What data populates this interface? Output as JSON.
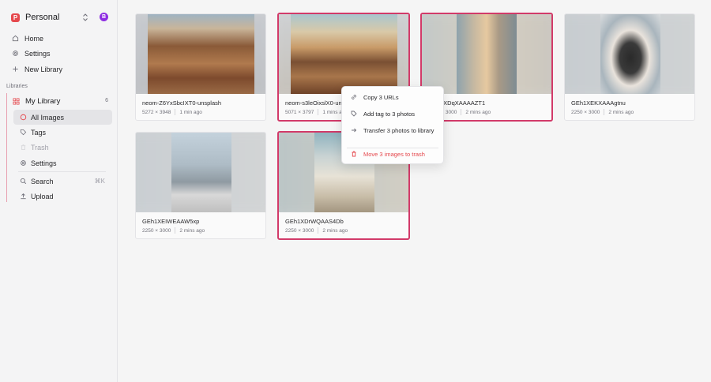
{
  "workspace": {
    "logo_letter": "P",
    "name": "Personal",
    "avatar_letter": "B"
  },
  "nav": [
    {
      "label": "Home",
      "icon": "home-icon"
    },
    {
      "label": "Settings",
      "icon": "gear-icon"
    },
    {
      "label": "New Library",
      "icon": "plus-icon"
    }
  ],
  "libraries_label": "Libraries",
  "library": {
    "name": "My Library",
    "count": "6",
    "items": [
      {
        "label": "All Images",
        "icon": "circle-icon",
        "active": true
      },
      {
        "label": "Tags",
        "icon": "tag-icon"
      },
      {
        "label": "Trash",
        "icon": "trash-icon",
        "disabled": true
      },
      {
        "label": "Settings",
        "icon": "gear-icon"
      }
    ],
    "search_label": "Search",
    "search_shortcut": "⌘K",
    "upload_label": "Upload"
  },
  "images": [
    {
      "name": "neom-Z6YxSbcIXT0-unsplash",
      "dims": "5272 × 3948",
      "time": "1 min ago",
      "selected": false
    },
    {
      "name": "neom-s3leOixslX0-unsplash",
      "dims": "5071 × 3797",
      "time": "1 mins ago",
      "selected": true
    },
    {
      "name": "GEh1XDqXAAAAZT1",
      "dims": "2250 × 3000",
      "time": "2 mins ago",
      "selected": true
    },
    {
      "name": "GEh1XEKXAAAgtnu",
      "dims": "2250 × 3000",
      "time": "2 mins ago",
      "selected": false
    },
    {
      "name": "GEh1XEIWEAAW5xp",
      "dims": "2250 × 3000",
      "time": "2 mins ago",
      "selected": false
    },
    {
      "name": "GEh1XDrWQAAS4Db",
      "dims": "2250 × 3000",
      "time": "2 mins ago",
      "selected": true
    }
  ],
  "context_menu": {
    "copy_urls": "Copy 3 URLs",
    "add_tag": "Add tag to 3 photos",
    "transfer": "Transfer 3 photos to library",
    "trash": "Move 3 images to trash"
  },
  "colors": {
    "accent": "#d23a69",
    "danger": "#e5484d",
    "logo": "#e5484d",
    "avatar": "#8e2de2"
  }
}
